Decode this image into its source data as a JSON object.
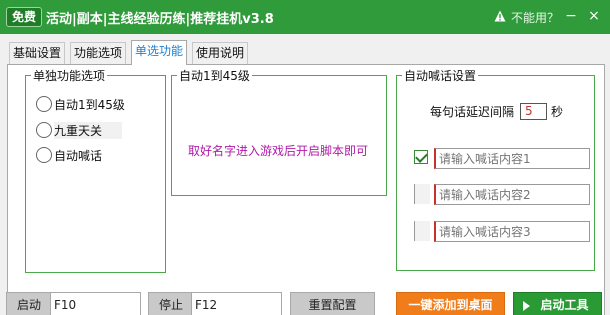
{
  "titlebar": {
    "free_badge": "免费",
    "title": "活动|副本|主线经验历练|推荐挂机v3.8",
    "warning_text": "不能用？",
    "minimize": "−",
    "close": "×"
  },
  "tabs": [
    {
      "label": "基础设置"
    },
    {
      "label": "功能选项"
    },
    {
      "label": "单选功能"
    },
    {
      "label": "使用说明"
    }
  ],
  "single_options": {
    "title": "单独功能选项",
    "radios": [
      {
        "label": "自动1到45级"
      },
      {
        "label": "九重天关"
      },
      {
        "label": "自动喊话"
      }
    ]
  },
  "auto_level": {
    "title": "自动1到45级",
    "hint": "取好名字进入游戏后开启脚本即可"
  },
  "auto_shout": {
    "title": "自动喊话设置",
    "delay_label": "每句话延迟间隔",
    "delay_value": "5",
    "delay_unit": "秒",
    "messages": [
      {
        "checked": true,
        "placeholder": "请输入喊话内容1"
      },
      {
        "checked": false,
        "placeholder": "请输入喊话内容2"
      },
      {
        "checked": false,
        "placeholder": "请输入喊话内容3"
      }
    ]
  },
  "buttons": {
    "start_label": "启动",
    "start_hotkey": "F10",
    "stop_label": "停止",
    "stop_hotkey": "F12",
    "reset_label": "重置配置",
    "add_desktop_label": "一键添加到桌面",
    "launch_label": "启动工具"
  },
  "colors": {
    "titlebar": "#2f9b3a",
    "group_border": "#4aa94a",
    "active_tab_text": "#1e7fd0",
    "hint_text": "#b01aa8",
    "input_text": "#c8302b",
    "orange_button": "#f07c1a",
    "green_button": "#2a9a35"
  }
}
